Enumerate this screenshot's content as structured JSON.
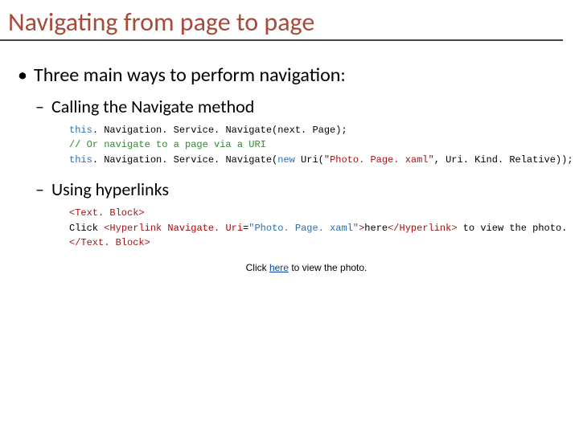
{
  "title": "Navigating from page to page",
  "bullets": {
    "main": "Three main ways to perform navigation:",
    "sub1": "Calling the Navigate method",
    "sub2": "Using hyperlinks"
  },
  "code1": {
    "kw_this_a": "this",
    "line1_rest": ". Navigation. Service. Navigate(next. Page);",
    "line2": "// Or navigate to a page via a URI",
    "kw_this_b": "this",
    "line3_a": ". Navigation. Service. Navigate(",
    "kw_new": "new",
    "line3_b": " Uri(",
    "str1": "\"Photo. Page. xaml\"",
    "line3_c": ", Uri. Kind. Relative));"
  },
  "code2": {
    "open_tb": "<Text. Block>",
    "line2_a": "Click ",
    "hyp_open": "<Hyperlink",
    "nav_attr": " Navigate. Uri",
    "eq": "=",
    "nav_val": "\"Photo. Page. xaml\"",
    "close_gt": ">",
    "here": "here",
    "hyp_close": "</Hyperlink>",
    "line2_b": " to view the photo.",
    "close_tb": "</Text. Block>"
  },
  "sample": {
    "pre": "Click ",
    "link": "here",
    "post": " to view the photo."
  }
}
